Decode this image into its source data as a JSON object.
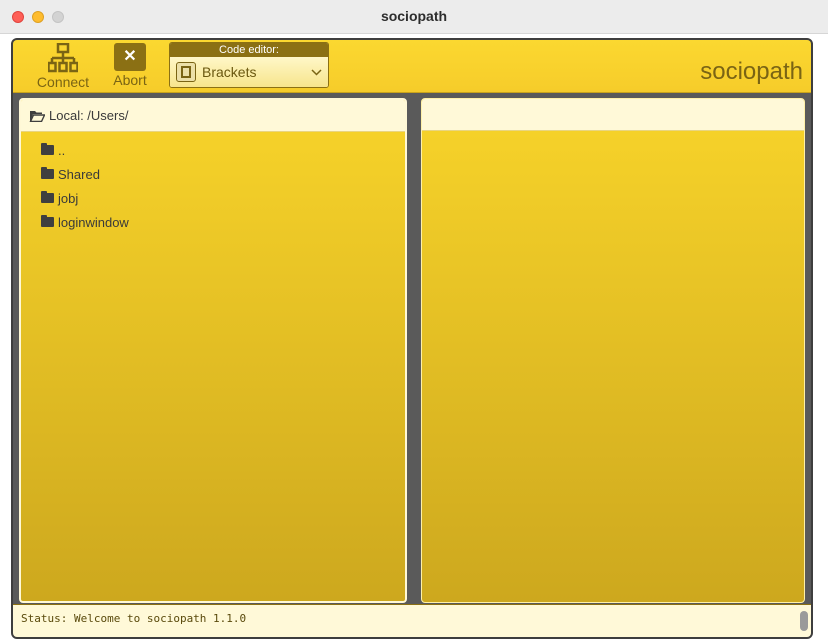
{
  "window": {
    "title": "sociopath"
  },
  "toolbar": {
    "connect_label": "Connect",
    "abort_label": "Abort",
    "abort_glyph": "✕",
    "editor_caption": "Code editor:",
    "editor_value": "Brackets",
    "brand": "sociopath"
  },
  "left_pane": {
    "header": "Local: /Users/",
    "items": [
      {
        "name": ".."
      },
      {
        "name": "Shared"
      },
      {
        "name": "jobj"
      },
      {
        "name": "loginwindow"
      }
    ]
  },
  "right_pane": {
    "header": ""
  },
  "status": {
    "text": "Status: Welcome to sociopath 1.1.0"
  },
  "colors": {
    "accent": "#f8d42a",
    "accent_dark": "#8b7014",
    "header_bg": "#fff9d8"
  }
}
